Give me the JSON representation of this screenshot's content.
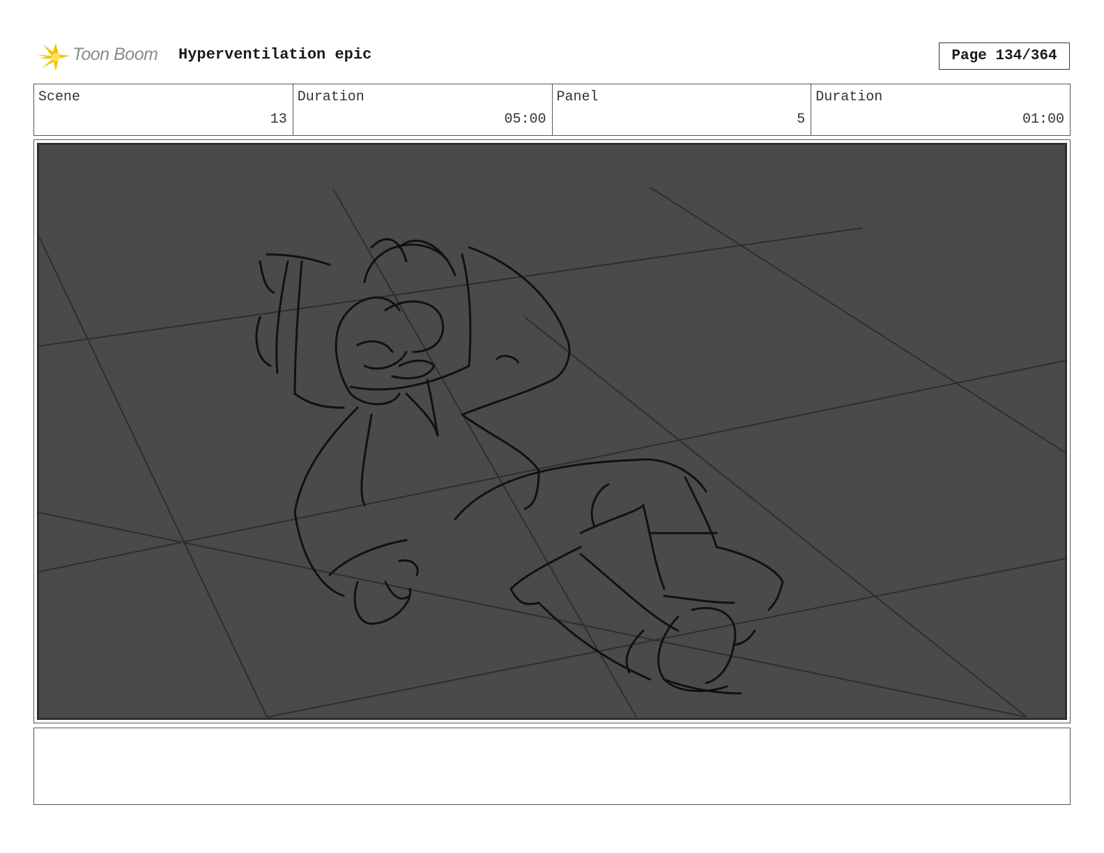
{
  "header": {
    "logo_text": "Toon Boom",
    "title": "Hyperventilation epic",
    "page_label": "Page 134/364"
  },
  "info": {
    "scene_label": "Scene",
    "scene_value": "13",
    "scene_duration_label": "Duration",
    "scene_duration_value": "05:00",
    "panel_label": "Panel",
    "panel_value": "5",
    "panel_duration_label": "Duration",
    "panel_duration_value": "01:00"
  },
  "panel": {
    "background_color": "#4a4a4a",
    "content": "sketch-drawing"
  },
  "notes": {
    "text": ""
  },
  "colors": {
    "logo_star": "#f5c400",
    "logo_text": "#8a8a8a",
    "panel_bg": "#4a4a4a",
    "sketch_line": "#111111"
  }
}
